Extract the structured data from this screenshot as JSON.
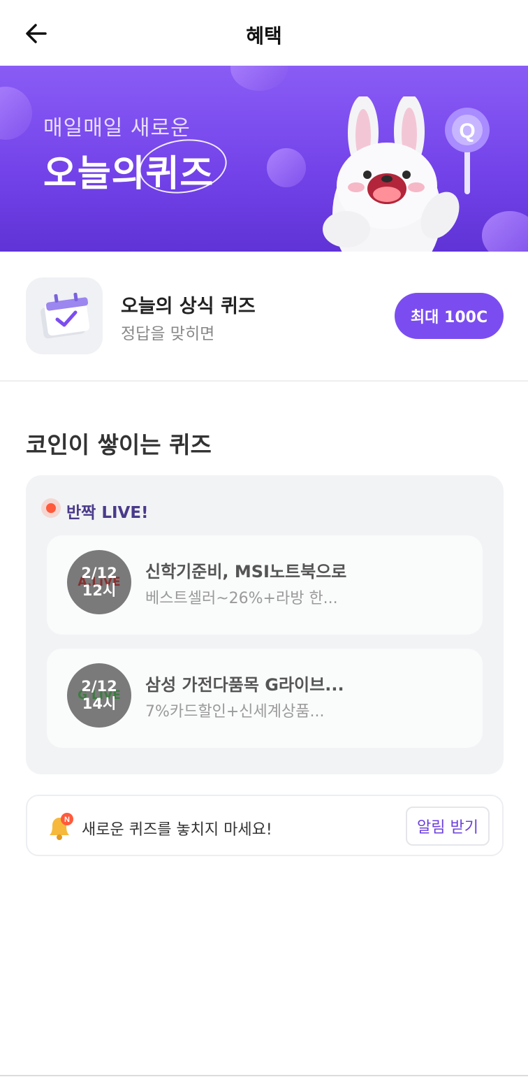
{
  "header": {
    "title": "혜택",
    "back_icon": "arrow-left-icon"
  },
  "banner": {
    "subtitle": "매일매일 새로운",
    "title_main": "오늘의",
    "title_highlight": "퀴즈",
    "background_color": "#7444ea"
  },
  "daily_quiz": {
    "icon": "calendar-check-icon",
    "title": "오늘의 상식 퀴즈",
    "description": "정답을 맞히면",
    "reward_label": "최대 100C",
    "accent_color": "#7b4df0"
  },
  "coin_quiz_section": {
    "title": "코인이 쌓이는 퀴즈",
    "live_label": "반짝 LIVE!",
    "live_color": "#ff5a3c",
    "items": [
      {
        "date": "2/12",
        "time": "12시",
        "logo_text": "A.LiVE",
        "title": "신학기준비, MSI노트북으로",
        "description": "베스트셀러~26%+라방 한..."
      },
      {
        "date": "2/12",
        "time": "14시",
        "logo_text": "G LIVE",
        "title": "삼성 가전다품목 G라이브...",
        "description": "7%카드할인+신세계상품..."
      }
    ]
  },
  "notification": {
    "icon": "bell-icon",
    "badge": "N",
    "text": "새로운 퀴즈를 놓치지 마세요!",
    "button_label": "알림 받기"
  }
}
